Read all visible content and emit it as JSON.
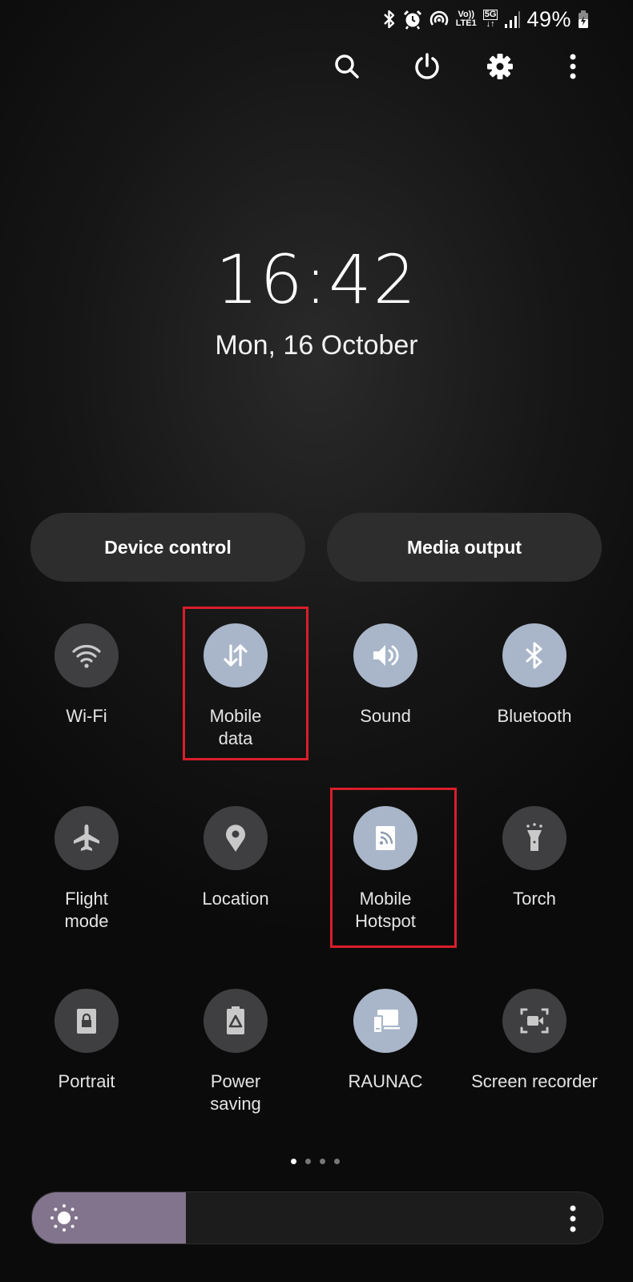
{
  "status_bar": {
    "icons": [
      "bluetooth-icon",
      "alarm-icon",
      "hotspot-icon",
      "volte-lte1-icon",
      "5g-data-icon",
      "signal-icon"
    ],
    "volte_label": "Vo))",
    "lte_label": "LTE1",
    "net_label": "5G",
    "battery_percent": "49%",
    "battery_state": "charging"
  },
  "top_actions": {
    "search": "search",
    "power": "power",
    "settings": "settings",
    "more": "more options"
  },
  "clock": {
    "time": "16:42",
    "date": "Mon, 16 October"
  },
  "pills": {
    "device_control": "Device control",
    "media_output": "Media output"
  },
  "tiles": [
    {
      "label": "Wi-Fi",
      "icon": "wifi-icon",
      "state": "off"
    },
    {
      "label": "Mobile\ndata",
      "icon": "mobile-data-icon",
      "state": "on",
      "highlighted": true
    },
    {
      "label": "Sound",
      "icon": "sound-icon",
      "state": "on"
    },
    {
      "label": "Bluetooth",
      "icon": "bluetooth-icon",
      "state": "on"
    },
    {
      "label": "Flight\nmode",
      "icon": "airplane-icon",
      "state": "off"
    },
    {
      "label": "Location",
      "icon": "location-icon",
      "state": "off"
    },
    {
      "label": "Mobile\nHotspot",
      "icon": "hotspot-icon",
      "state": "on",
      "highlighted": true
    },
    {
      "label": "Torch",
      "icon": "torch-icon",
      "state": "off"
    },
    {
      "label": "Portrait",
      "icon": "portrait-lock-icon",
      "state": "off"
    },
    {
      "label": "Power\nsaving",
      "icon": "power-saving-icon",
      "state": "off"
    },
    {
      "label": "RAUNAC",
      "icon": "devices-icon",
      "state": "on"
    },
    {
      "label": "Screen recorder",
      "icon": "screen-recorder-icon",
      "state": "off"
    }
  ],
  "pager": {
    "pages": 4,
    "current": 1
  },
  "brightness": {
    "level": 0.27
  },
  "colors": {
    "tile_on": "#a9b6c9",
    "tile_off": "#3f3f41",
    "highlight": "#d91e2a",
    "brightness_fill": "#82748c"
  }
}
